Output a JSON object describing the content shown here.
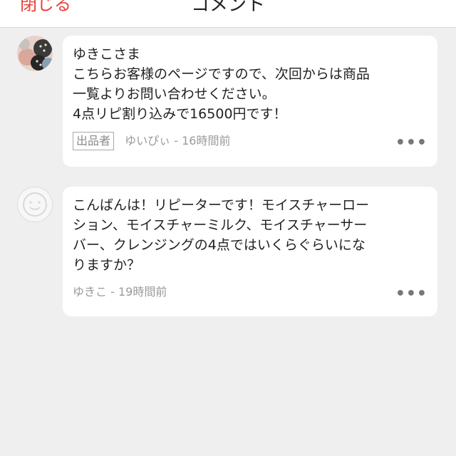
{
  "header": {
    "close_label": "閉じる",
    "title": "コメント"
  },
  "comments": [
    {
      "text": "ゆきこさま\nこちらお客様のページですので、次回からは商品\n一覧よりお問い合わせください。\n4点リピ割り込みで16500円です！",
      "badge": "出品者",
      "author": "ゆいぴぃ",
      "time": "16時間前",
      "more_icon": "more-dots-icon"
    },
    {
      "text": "こんばんは！リピーターです！モイスチャーロー\nション、モイスチャーミルク、モイスチャーサー\nバー、クレンジングの4点ではいくらぐらいにな\nりますか？",
      "author": "ゆきこ",
      "time": "19時間前",
      "more_icon": "more-dots-icon"
    }
  ],
  "colors": {
    "accent": "#e8403a",
    "background": "#efefef",
    "bubble": "#ffffff"
  }
}
